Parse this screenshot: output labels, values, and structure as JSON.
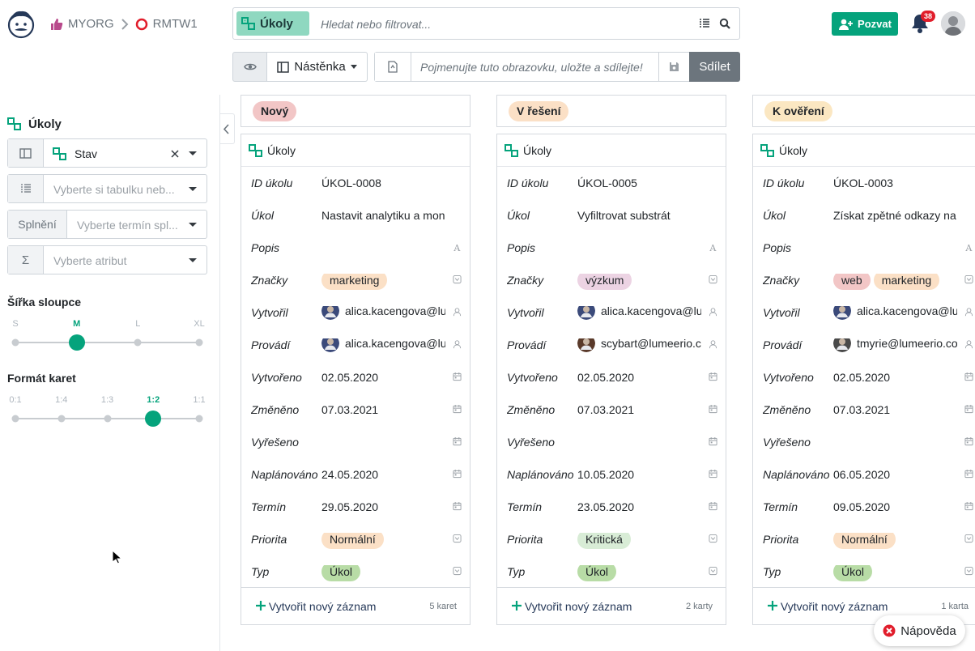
{
  "colors": {
    "accent": "#05a37c",
    "tag_new": "#f2c6c6",
    "tag_progress": "#fbe0c6",
    "tag_review": "#fbe7c2",
    "tag_marketing": "#fbe0c6",
    "tag_research": "#ecd3e3",
    "tag_web": "#f2c6c6",
    "tag_normal": "#fbe0c6",
    "tag_critical": "#d8ecd6",
    "tag_task": "#b8dca6"
  },
  "breadcrumb": {
    "org": "MYORG",
    "project": "RMTW1"
  },
  "search": {
    "collection": "Úkoly",
    "placeholder": "Hledat nebo filtrovat..."
  },
  "header": {
    "invite_label": "Pozvat",
    "notifications": "38"
  },
  "viewbar": {
    "view_label": "Nástěnka",
    "name_placeholder": "Pojmenujte tuto obrazovku, uložte a sdílejte!",
    "share_label": "Sdílet"
  },
  "sidebar": {
    "title": "Úkoly",
    "group_value": "Stav",
    "table_placeholder": "Vyberte si tabulku neb...",
    "due_prefix": "Splnění",
    "due_placeholder": "Vyberte termín spl...",
    "sum_placeholder": "Vyberte atribut",
    "width_label": "Šířka sloupce",
    "width_ticks": [
      "S",
      "M",
      "L",
      "XL"
    ],
    "width_selected": 1,
    "format_label": "Formát karet",
    "format_ticks": [
      "0:1",
      "1:4",
      "1:3",
      "1:2",
      "1:1"
    ],
    "format_selected": 3
  },
  "columns": [
    {
      "status": "Nový",
      "collection": "Úkoly",
      "count": "5 karet",
      "add_label": "Vytvořit nový záznam",
      "fields": {
        "id": "ÚKOL-0008",
        "task": "Nastavit analytiku a monitorování",
        "tags": [
          "marketing"
        ],
        "created_by": "alica.kacengova@lumeerio.com",
        "assignee": "alica.kacengova@lumeerio.com",
        "created": "02.05.2020",
        "changed": "07.03.2021",
        "resolved": "",
        "planned": "24.05.2020",
        "due": "29.05.2020",
        "priority": "Normální",
        "type": "Úkol"
      }
    },
    {
      "status": "V řešení",
      "collection": "Úkoly",
      "count": "2 karty",
      "add_label": "Vytvořit nový záznam",
      "fields": {
        "id": "ÚKOL-0005",
        "task": "Vyfiltrovat substrát",
        "tags": [
          "výzkum"
        ],
        "created_by": "alica.kacengova@lumeerio.com",
        "assignee": "scybart@lumeerio.com",
        "created": "02.05.2020",
        "changed": "07.03.2021",
        "resolved": "",
        "planned": "10.05.2020",
        "due": "23.05.2020",
        "priority": "Kritická",
        "type": "Úkol"
      }
    },
    {
      "status": "K ověření",
      "collection": "Úkoly",
      "count": "1 karta",
      "add_label": "Vytvořit nový záznam",
      "fields": {
        "id": "ÚKOL-0003",
        "task": "Získat zpětné odkazy na web",
        "tags": [
          "web",
          "marketing"
        ],
        "created_by": "alica.kacengova@lumeerio.com",
        "assignee": "tmyrie@lumeerio.com",
        "created": "02.05.2020",
        "changed": "07.03.2021",
        "resolved": "",
        "planned": "06.05.2020",
        "due": "09.05.2020",
        "priority": "Normální",
        "type": "Úkol"
      }
    }
  ],
  "field_labels": {
    "id": "ID úkolu",
    "task": "Úkol",
    "desc": "Popis",
    "tags": "Značky",
    "created_by": "Vytvořil",
    "assignee": "Provádí",
    "created": "Vytvořeno",
    "changed": "Změněno",
    "resolved": "Vyřešeno",
    "planned": "Naplánováno",
    "due": "Termín",
    "priority": "Priorita",
    "type": "Typ"
  },
  "help_label": "Nápověda"
}
